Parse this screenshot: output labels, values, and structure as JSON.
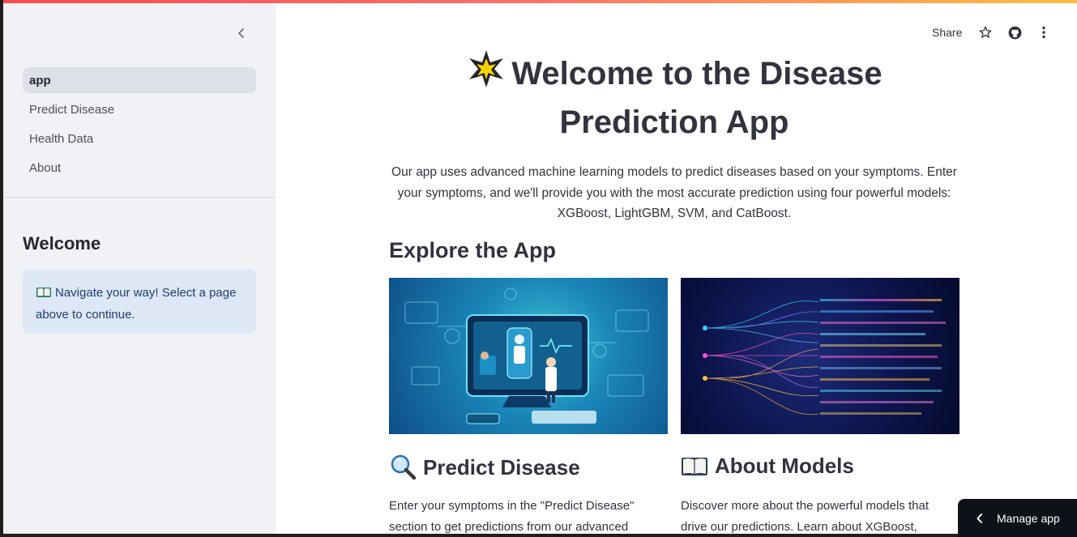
{
  "sidebar": {
    "nav_items": [
      {
        "label": "app",
        "active": true
      },
      {
        "label": "Predict Disease",
        "active": false
      },
      {
        "label": "Health Data",
        "active": false
      },
      {
        "label": "About",
        "active": false
      }
    ],
    "welcome_title": "Welcome",
    "info_text": "Navigate your way! Select a page above to continue.",
    "info_icon": "open-book-icon"
  },
  "header": {
    "share_label": "Share",
    "icons": [
      "star-icon",
      "github-icon",
      "more-vertical-icon"
    ]
  },
  "main": {
    "title_icon": "glowing-star-icon",
    "title": "Welcome to the Disease Prediction App",
    "intro": "Our app uses advanced machine learning models to predict diseases based on your symptoms. Enter your symptoms, and we'll provide you with the most accurate prediction using four powerful models: XGBoost, LightGBM, SVM, and CatBoost.",
    "explore_heading": "Explore the App",
    "sections": [
      {
        "icon": "magnifier-icon",
        "heading": "Predict Disease",
        "text": "Enter your symptoms in the \"Predict Disease\" section to get predictions from our advanced"
      },
      {
        "icon": "open-book-icon",
        "heading": "About Models",
        "text": "Discover more about the powerful models that drive our predictions. Learn about XGBoost,"
      }
    ]
  },
  "manage_app": {
    "label": "Manage app"
  },
  "colors": {
    "sidebar_bg": "#f0f2f6",
    "active_nav_bg": "#dde0e8",
    "info_bg": "#dde7f5",
    "info_text": "#1f3e74",
    "accent_stripe": "#ff4b4b",
    "manage_bg": "#0e1117"
  }
}
